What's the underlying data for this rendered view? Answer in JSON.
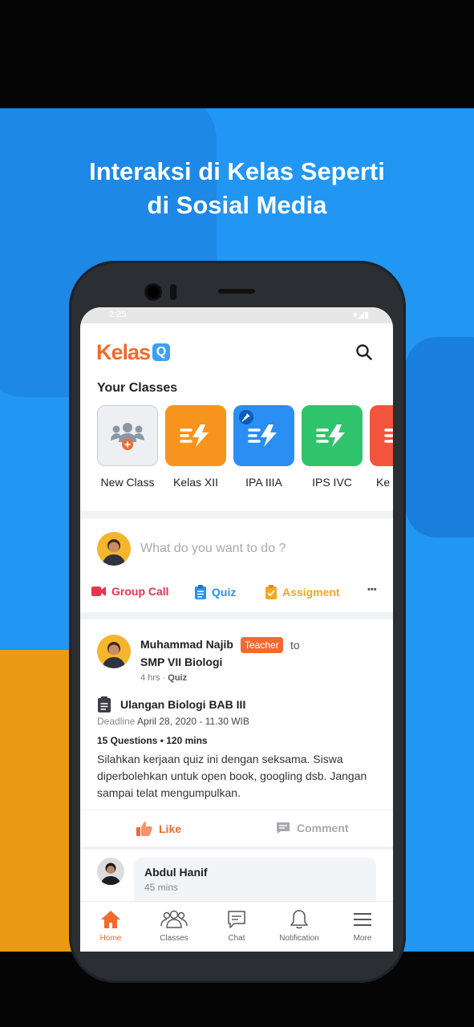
{
  "promo": {
    "headline_line1": "Interaksi di Kelas Seperti",
    "headline_line2": "di Sosial Media"
  },
  "status": {
    "time": "2:25"
  },
  "app": {
    "logo_text": "Kelas",
    "logo_badge": "Q"
  },
  "classes": {
    "title": "Your Classes",
    "items": [
      {
        "label": "New Class",
        "color": "#eeeff3",
        "icon": "new-class-icon"
      },
      {
        "label": "Kelas XII",
        "color": "#f7941d",
        "icon": "class-bolt-icon"
      },
      {
        "label": "IPA IIIA",
        "color": "#2a8ef2",
        "icon": "class-bolt-icon",
        "pinned": true
      },
      {
        "label": "IPS IVC",
        "color": "#2fc46b",
        "icon": "class-bolt-icon"
      },
      {
        "label": "Ke",
        "color": "#f2543d",
        "icon": "class-bolt-icon"
      }
    ]
  },
  "composer": {
    "placeholder": "What do you want to do ?",
    "actions": [
      {
        "label": "Group Call",
        "color": "#e8344e",
        "icon": "video-icon"
      },
      {
        "label": "Quiz",
        "color": "#2a8ef2",
        "icon": "quiz-icon"
      },
      {
        "label": "Assigment",
        "color": "#f5a623",
        "icon": "assignment-icon"
      }
    ],
    "more": "•••"
  },
  "post": {
    "author": "Muhammad Najib",
    "role_badge": "Teacher",
    "to": "to",
    "class": "SMP VII Biologi",
    "time": "4 hrs",
    "separator": "·",
    "type": "Quiz",
    "quiz_title": "Ulangan Biologi BAB III",
    "deadline_label": "Deadline",
    "deadline_value": "April 28, 2020 - 11.30 WIB",
    "questions": "15 Questions • 120 mins",
    "body": "Silahkan kerjaan quiz ini dengan seksama. Siswa diperbolehkan untuk open book, googling dsb. Jangan sampai telat mengumpulkan.",
    "like": "Like",
    "comment": "Comment"
  },
  "comment": {
    "author": "Abdul Hanif",
    "time": "45 mins"
  },
  "nav": [
    {
      "label": "Home",
      "icon": "home-icon",
      "active": true
    },
    {
      "label": "Classes",
      "icon": "classes-icon"
    },
    {
      "label": "Chat",
      "icon": "chat-icon"
    },
    {
      "label": "Notification",
      "icon": "bell-icon"
    },
    {
      "label": "More",
      "icon": "menu-icon"
    }
  ],
  "colors": {
    "brand_blue": "#2196f3",
    "brand_orange": "#f26a2e",
    "accent_orange": "#e89a12"
  }
}
